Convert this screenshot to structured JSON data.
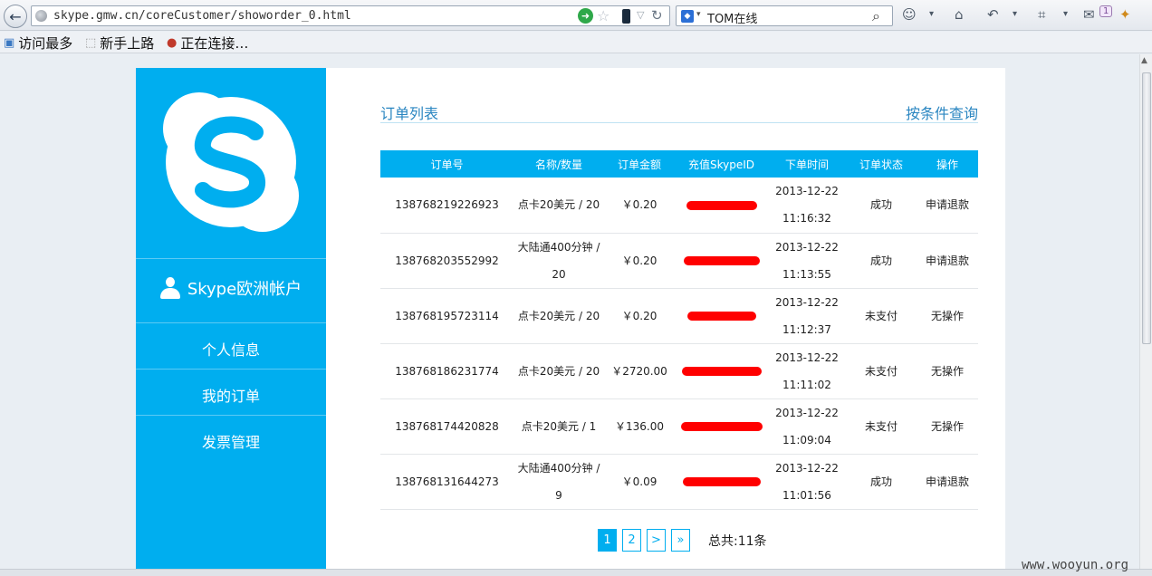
{
  "browser": {
    "url": "skype.gmw.cn/coreCustomer/showorder_0.html",
    "search_text": "TOM在线",
    "bookmarks": [
      "访问最多",
      "新手上路",
      "正在连接…"
    ],
    "notification_count": "1"
  },
  "sidebar": {
    "account_label": "Skype欧洲帐户",
    "items": [
      {
        "label": "个人信息"
      },
      {
        "label": "我的订单"
      },
      {
        "label": "发票管理"
      }
    ]
  },
  "main": {
    "section_title": "订单列表",
    "query_link": "按条件查询",
    "table": {
      "headers": [
        "订单号",
        "名称/数量",
        "订单金额",
        "充值SkypeID",
        "下单时间",
        "订单状态",
        "操作"
      ],
      "rows": [
        {
          "order_id": "138768219226923",
          "name_qty": "点卡20美元 / 20",
          "amount": "￥0.20",
          "date": "2013-12-22",
          "time": "11:16:32",
          "status": "成功",
          "action": "申请退款"
        },
        {
          "order_id": "138768203552992",
          "name_qty": "大陆通400分钟 / 20",
          "amount": "￥0.20",
          "date": "2013-12-22",
          "time": "11:13:55",
          "status": "成功",
          "action": "申请退款"
        },
        {
          "order_id": "138768195723114",
          "name_qty": "点卡20美元 / 20",
          "amount": "￥0.20",
          "date": "2013-12-22",
          "time": "11:12:37",
          "status": "未支付",
          "action": "无操作"
        },
        {
          "order_id": "138768186231774",
          "name_qty": "点卡20美元 / 20",
          "amount": "￥2720.00",
          "date": "2013-12-22",
          "time": "11:11:02",
          "status": "未支付",
          "action": "无操作"
        },
        {
          "order_id": "138768174420828",
          "name_qty": "点卡20美元 / 1",
          "amount": "￥136.00",
          "date": "2013-12-22",
          "time": "11:09:04",
          "status": "未支付",
          "action": "无操作"
        },
        {
          "order_id": "138768131644273",
          "name_qty": "大陆通400分钟 / 9",
          "amount": "￥0.09",
          "date": "2013-12-22",
          "time": "11:01:56",
          "status": "成功",
          "action": "申请退款"
        }
      ]
    },
    "pagination": {
      "pages": [
        "1",
        "2"
      ],
      "next": ">",
      "last": "»",
      "total": "总共:11条"
    }
  },
  "watermark": "www.wooyun.org",
  "colors": {
    "accent": "#00aeef",
    "link": "#2a86c1",
    "redaction": "#ff0000"
  }
}
